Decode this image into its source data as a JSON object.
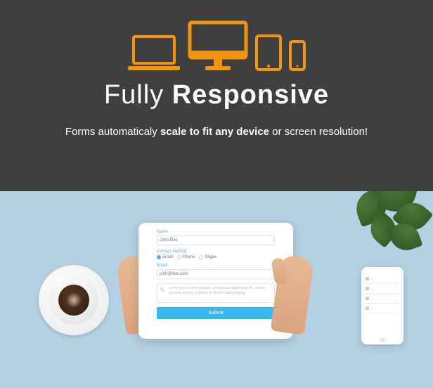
{
  "headline": {
    "light": "Fully",
    "bold": "Responsive"
  },
  "sub": {
    "pre": "Forms automaticaly ",
    "bold": "scale to fit any device",
    "post": " or screen resolution!"
  },
  "form": {
    "name_label": "Name",
    "name_value": "John Doe",
    "contact_label": "Contact method",
    "opt_email": "Email",
    "opt_phone": "Phone",
    "opt_skype": "Skype",
    "email_label": "Email",
    "email_value": "john@doe.com",
    "message_text": "Lorem ipsum dolor sit amet, consectetur adipiscing elit, sed do eiusmod tempor ut labore et dolore magna aliqua",
    "submit": "Submit"
  },
  "colors": {
    "accent": "#f39313",
    "button": "#39b8f0",
    "bg_top": "#3f3f3f",
    "bg_bottom": "#b4d0e3"
  }
}
